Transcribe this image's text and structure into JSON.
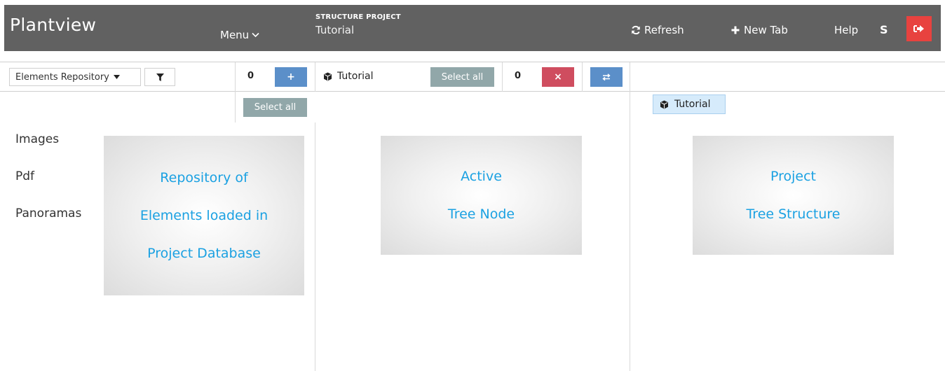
{
  "header": {
    "brand": "Plantview",
    "menu_label": "Menu",
    "project_kicker": "STRUCTURE PROJECT",
    "project_name": "Tutorial",
    "refresh_label": "Refresh",
    "new_tab_label": "New Tab",
    "help_label": "Help",
    "user_initial": "S"
  },
  "toolbar": {
    "repository_select": "Elements Repository",
    "left_count": "0",
    "add_symbol": "+",
    "node_title": "Tutorial",
    "select_all_label": "Select all",
    "middle_count": "0",
    "remove_symbol": "×"
  },
  "repository": {
    "select_all_label": "Select all",
    "categories": [
      "Images",
      "Pdf",
      "Panoramas"
    ],
    "info_lines": [
      "Repository of",
      "Elements loaded in",
      "Project Database"
    ]
  },
  "active_node": {
    "info_lines": [
      "Active",
      "Tree Node"
    ]
  },
  "tree": {
    "root_label": "Tutorial",
    "info_lines": [
      "Project",
      "Tree Structure"
    ]
  },
  "colors": {
    "header_bg": "#616161",
    "blue_button": "#5b8fc9",
    "red_button": "#cf4d5f",
    "logout_button": "#e8423f",
    "select_all_button": "#91a7a9",
    "info_text": "#1ba1e2",
    "tree_chip_bg": "#d6ebfb"
  },
  "icons": [
    "chevron-down-icon",
    "refresh-icon",
    "plus-icon",
    "logout-icon",
    "caret-down-icon",
    "filter-icon",
    "cube-icon",
    "close-icon",
    "swap-icon"
  ]
}
